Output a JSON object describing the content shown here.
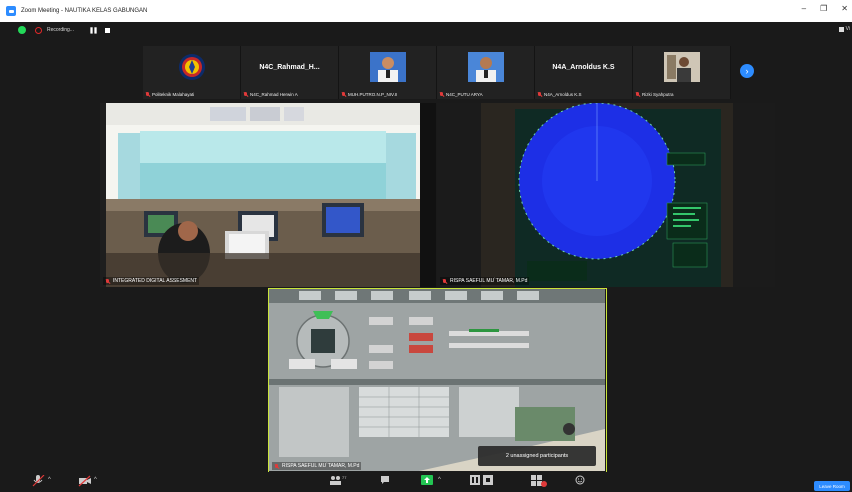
{
  "window": {
    "title": "Zoom Meeting - NAUTIKA KELAS GABUNGAN",
    "minimize": "–",
    "maximize": "❐",
    "close": "✕"
  },
  "meeting": {
    "recording_label": "Recording...",
    "pause_label": "❚❚",
    "view_label": "Vi"
  },
  "gallery": [
    {
      "label": "Politeknik Malahayati",
      "big_name": "",
      "type": "logo"
    },
    {
      "label": "N4C_Rahmad Herwin A",
      "big_name": "N4C_Rahmad_H...",
      "type": "text"
    },
    {
      "label": "MUH.PUTRO.N.P_NIV.II",
      "big_name": "",
      "type": "photo"
    },
    {
      "label": "N4C_PUTU ARYA",
      "big_name": "",
      "type": "photo"
    },
    {
      "label": "N4A_Arnoldus K.S",
      "big_name": "N4A_Arnoldus K.S",
      "type": "text"
    },
    {
      "label": "Rizki Syahputra",
      "big_name": "",
      "type": "photo2"
    }
  ],
  "videos": [
    {
      "label": "INTEGRATED DIGITAL ASSESMENT"
    },
    {
      "label": "RISPA SAEFUL MU`TAMAR, M.Pd"
    },
    {
      "label": "RISPA SAEFUL MU`TAMAR, M.Pd"
    }
  ],
  "tooltip": "2 unassigned participants",
  "toolbar": {
    "participants_count": "77",
    "leave_label": "Leave Room"
  },
  "colors": {
    "accent": "#2d8cff",
    "active_speaker": "#c9e43a",
    "muted": "#e03a3a",
    "shield": "#23d959"
  }
}
